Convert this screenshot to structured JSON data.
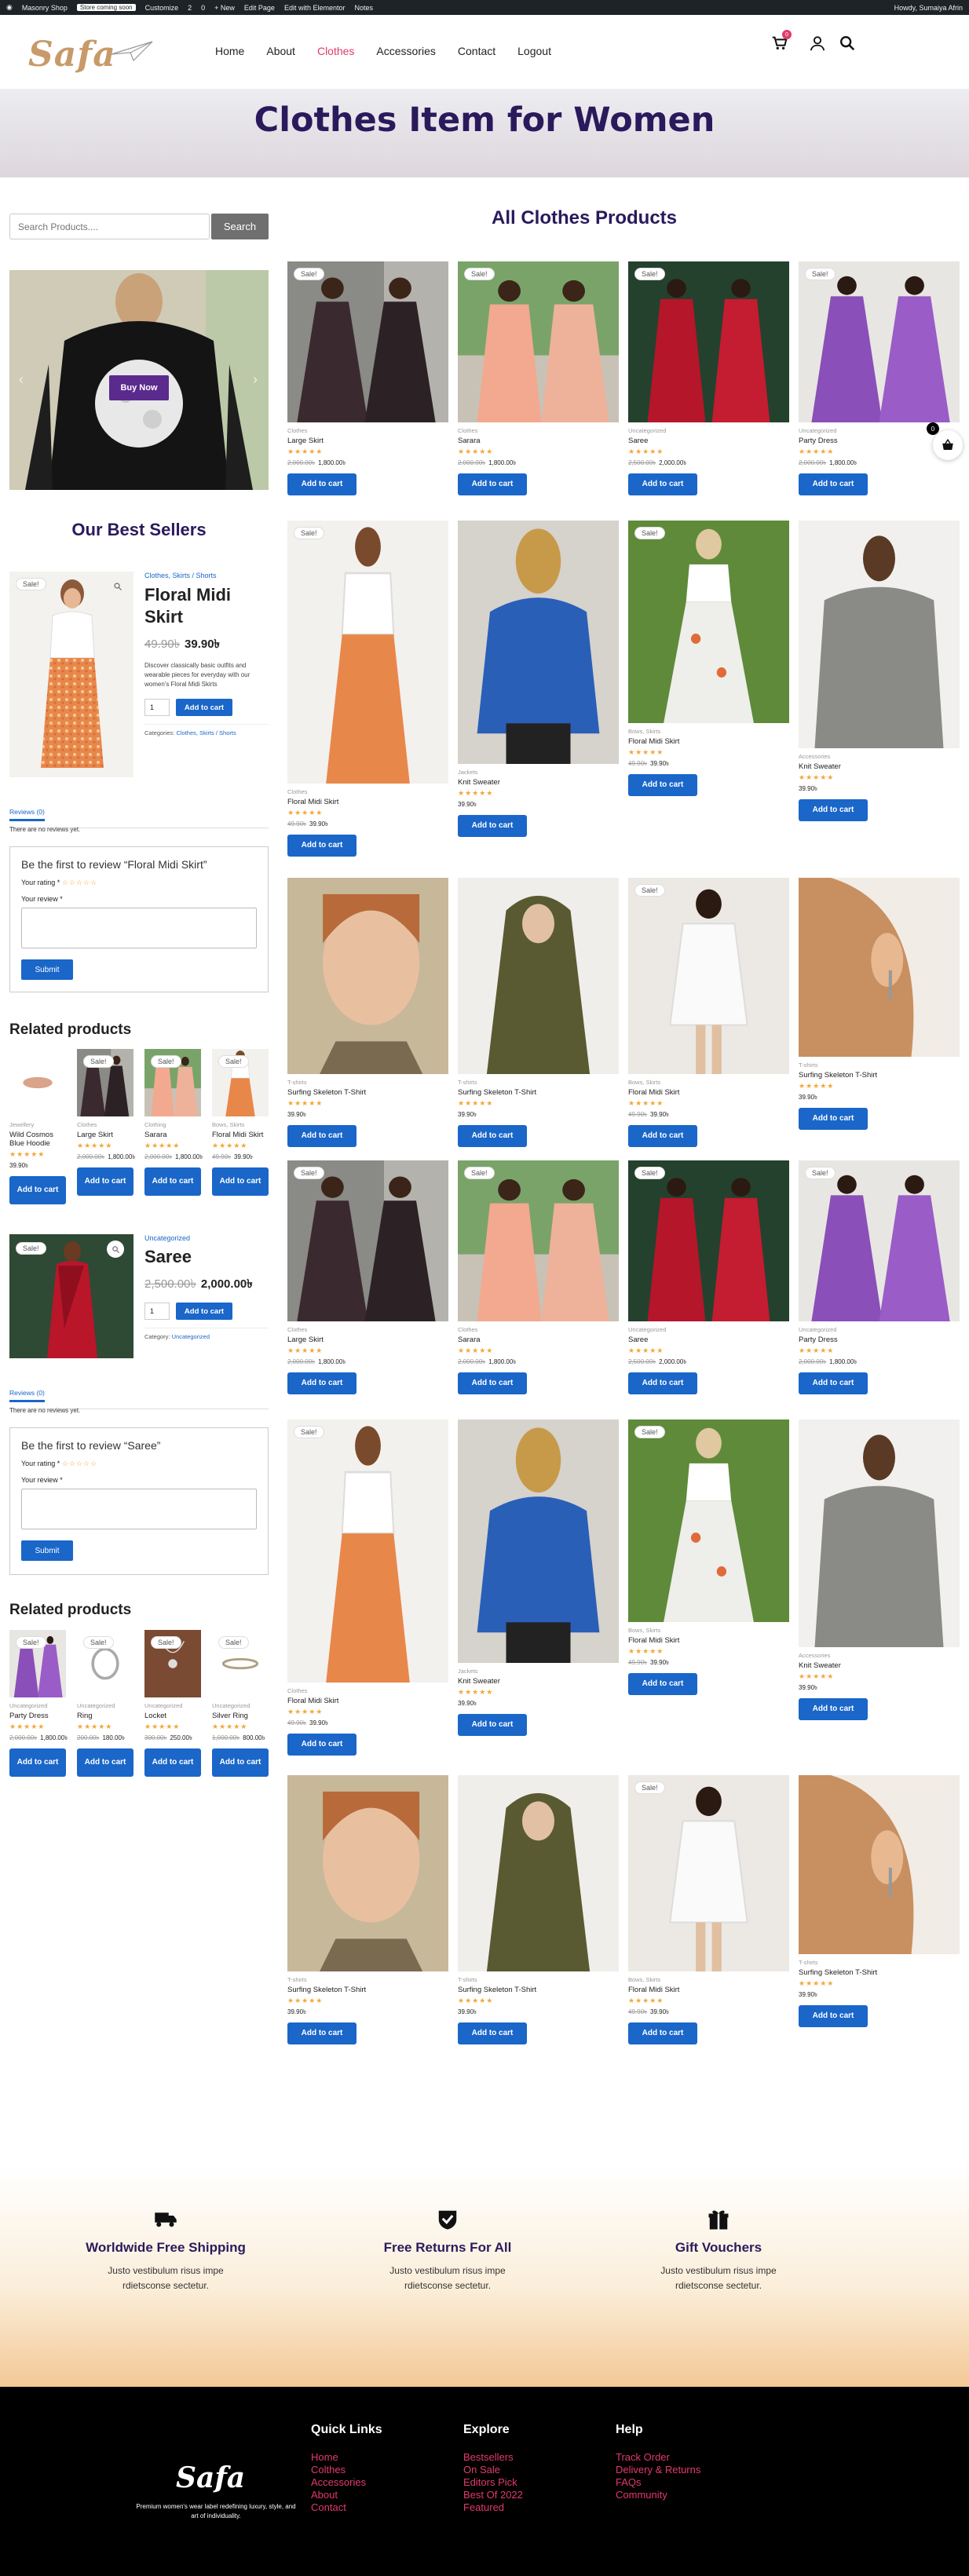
{
  "admin_bar": {
    "items": [
      "Masonry Shop",
      "Customize",
      "2",
      "0",
      "+ New",
      "Edit Page",
      "Edit with Elementor",
      "Notes"
    ],
    "pill": "Store coming soon",
    "greeting": "Howdy, Sumaiya Afrin"
  },
  "header": {
    "logo": "Safa",
    "nav": [
      "Home",
      "About",
      "Clothes",
      "Accessories",
      "Contact",
      "Logout"
    ],
    "active_nav": "Clothes",
    "cart_count": "0"
  },
  "hero": {
    "title": "Clothes Item for Women"
  },
  "sidebar": {
    "search": {
      "placeholder": "Search Products....",
      "button": "Search"
    },
    "banner_button": "Buy Now",
    "best_sellers_title": "Our Best Sellers",
    "featured1": {
      "breadcrumb": "Clothes, Skirts / Shorts",
      "name": "Floral Midi Skirt",
      "old_price": "49.90৳",
      "price": "39.90৳",
      "desc": "Discover classically basic outfits and wearable pieces for everyday with our women's Floral Midi Skirts",
      "qty": "1",
      "add_btn": "Add to cart",
      "categories_label": "Categories:",
      "categories": "Clothes, Skirts / Shorts",
      "sale": "Sale!"
    },
    "reviews1": {
      "tab": "Reviews (0)",
      "none": "There are no reviews yet.",
      "title": "Be the first to review “Floral Midi Skirt”",
      "rating_label": "Your rating *",
      "review_label": "Your review *",
      "submit": "Submit"
    },
    "related1": {
      "title": "Related products",
      "items": [
        {
          "cat": "Jewellery",
          "name": "Wild Cosmos Blue Hoodie",
          "old": "",
          "price": "39.90৳",
          "btn": "Add to cart",
          "sale": ""
        },
        {
          "cat": "Clothes",
          "name": "Large Skirt",
          "old": "2,000.00৳",
          "price": "1,800.00৳",
          "btn": "Add to cart",
          "sale": "Sale!"
        },
        {
          "cat": "Clothing",
          "name": "Sarara",
          "old": "2,000.00৳",
          "price": "1,800.00৳",
          "btn": "Add to cart",
          "sale": "Sale!"
        },
        {
          "cat": "Bows, Skirts",
          "name": "Floral Midi Skirt",
          "old": "49.90৳",
          "price": "39.90৳",
          "btn": "Add to cart",
          "sale": "Sale!"
        }
      ]
    },
    "featured2": {
      "category": "Uncategorized",
      "name": "Saree",
      "old_price": "2,500.00৳",
      "price": "2,000.00৳",
      "qty": "1",
      "add_btn": "Add to cart",
      "categories_label": "Category:",
      "categories": "Uncategorized",
      "sale": "Sale!"
    },
    "reviews2": {
      "tab": "Reviews (0)",
      "none": "There are no reviews yet.",
      "title": "Be the first to review “Saree”",
      "rating_label": "Your rating *",
      "review_label": "Your review *",
      "submit": "Submit"
    },
    "related2": {
      "title": "Related products",
      "items": [
        {
          "cat": "Uncategorized",
          "name": "Party Dress",
          "old": "2,000.00৳",
          "price": "1,800.00৳",
          "btn": "Add to cart",
          "sale": "Sale!"
        },
        {
          "cat": "Uncategorized",
          "name": "Ring",
          "old": "200.00৳",
          "price": "180.00৳",
          "btn": "Add to cart",
          "sale": "Sale!"
        },
        {
          "cat": "Uncategorized",
          "name": "Locket",
          "old": "300.00৳",
          "price": "250.00৳",
          "btn": "Add to cart",
          "sale": "Sale!"
        },
        {
          "cat": "Uncategorized",
          "name": "Silver Ring",
          "old": "1,000.00৳",
          "price": "800.00৳",
          "btn": "Add to cart",
          "sale": "Sale!"
        }
      ]
    }
  },
  "main": {
    "title": "All Clothes Products",
    "products": [
      {
        "cat": "Clothes",
        "name": "Large Skirt",
        "old": "2,000.00৳",
        "price": "1,800.00৳",
        "btn": "Add to cart",
        "sale": "Sale!"
      },
      {
        "cat": "Clothes",
        "name": "Sarara",
        "old": "2,000.00৳",
        "price": "1,800.00৳",
        "btn": "Add to cart",
        "sale": "Sale!"
      },
      {
        "cat": "Uncategorized",
        "name": "Saree",
        "old": "2,500.00৳",
        "price": "2,000.00৳",
        "btn": "Add to cart",
        "sale": "Sale!"
      },
      {
        "cat": "Uncategorized",
        "name": "Party Dress",
        "old": "2,000.00৳",
        "price": "1,800.00৳",
        "btn": "Add to cart",
        "sale": "Sale!"
      },
      {
        "cat": "Clothes",
        "name": "Floral Midi Skirt",
        "old": "49.90৳",
        "price": "39.90৳",
        "btn": "Add to cart",
        "sale": "Sale!"
      },
      {
        "cat": "Jackets",
        "name": "Knit Sweater",
        "old": "",
        "price": "39.90৳",
        "btn": "Add to cart",
        "sale": ""
      },
      {
        "cat": "Bows, Skirts",
        "name": "Floral Midi Skirt",
        "old": "49.90৳",
        "price": "39.90৳",
        "btn": "Add to cart",
        "sale": "Sale!"
      },
      {
        "cat": "Accessories",
        "name": "Knit Sweater",
        "old": "",
        "price": "39.90৳",
        "btn": "Add to cart",
        "sale": ""
      },
      {
        "cat": "T-shirts",
        "name": "Surfing Skeleton T-Shirt",
        "old": "",
        "price": "39.90৳",
        "btn": "Add to cart",
        "sale": ""
      },
      {
        "cat": "T-shirts",
        "name": "Surfing Skeleton T-Shirt",
        "old": "",
        "price": "39.90৳",
        "btn": "Add to cart",
        "sale": ""
      },
      {
        "cat": "Bows, Skirts",
        "name": "Floral Midi Skirt",
        "old": "49.90৳",
        "price": "39.90৳",
        "btn": "Add to cart",
        "sale": "Sale!"
      },
      {
        "cat": "T-shirts",
        "name": "Surfing Skeleton T-Shirt",
        "old": "",
        "price": "39.90৳",
        "btn": "Add to cart",
        "sale": ""
      },
      {
        "cat": "Clothes",
        "name": "Large Skirt",
        "old": "2,000.00৳",
        "price": "1,800.00৳",
        "btn": "Add to cart",
        "sale": "Sale!"
      },
      {
        "cat": "Clothes",
        "name": "Sarara",
        "old": "2,000.00৳",
        "price": "1,800.00৳",
        "btn": "Add to cart",
        "sale": "Sale!"
      },
      {
        "cat": "Uncategorized",
        "name": "Saree",
        "old": "2,500.00৳",
        "price": "2,000.00৳",
        "btn": "Add to cart",
        "sale": "Sale!"
      },
      {
        "cat": "Uncategorized",
        "name": "Party Dress",
        "old": "2,000.00৳",
        "price": "1,800.00৳",
        "btn": "Add to cart",
        "sale": "Sale!"
      },
      {
        "cat": "Clothes",
        "name": "Floral Midi Skirt",
        "old": "49.90৳",
        "price": "39.90৳",
        "btn": "Add to cart",
        "sale": "Sale!"
      },
      {
        "cat": "Jackets",
        "name": "Knit Sweater",
        "old": "",
        "price": "39.90৳",
        "btn": "Add to cart",
        "sale": ""
      },
      {
        "cat": "Bows, Skirts",
        "name": "Floral Midi Skirt",
        "old": "49.90৳",
        "price": "39.90৳",
        "btn": "Add to cart",
        "sale": "Sale!"
      },
      {
        "cat": "Accessories",
        "name": "Knit Sweater",
        "old": "",
        "price": "39.90৳",
        "btn": "Add to cart",
        "sale": ""
      },
      {
        "cat": "T-shirts",
        "name": "Surfing Skeleton T-Shirt",
        "old": "",
        "price": "39.90৳",
        "btn": "Add to cart",
        "sale": ""
      },
      {
        "cat": "T-shirts",
        "name": "Surfing Skeleton T-Shirt",
        "old": "",
        "price": "39.90৳",
        "btn": "Add to cart",
        "sale": ""
      },
      {
        "cat": "Bows, Skirts",
        "name": "Floral Midi Skirt",
        "old": "49.90৳",
        "price": "39.90৳",
        "btn": "Add to cart",
        "sale": "Sale!"
      },
      {
        "cat": "T-shirts",
        "name": "Surfing Skeleton T-Shirt",
        "old": "",
        "price": "39.90৳",
        "btn": "Add to cart",
        "sale": ""
      }
    ]
  },
  "features": [
    {
      "icon": "truck-icon",
      "title": "Worldwide Free Shipping",
      "desc": "Justo vestibulum risus impe rdietsconse sectetur."
    },
    {
      "icon": "shield-check-icon",
      "title": "Free Returns For All",
      "desc": "Justo vestibulum risus impe rdietsconse sectetur."
    },
    {
      "icon": "gift-icon",
      "title": "Gift Vouchers",
      "desc": "Justo vestibulum risus impe rdietsconse sectetur."
    }
  ],
  "footer": {
    "logo": "Safa",
    "tagline": "Premium women's wear label redefining luxury, style, and art of individuality.",
    "columns": [
      {
        "title": "Quick Links",
        "links": [
          "Home",
          "Colthes",
          "Accessories",
          "About",
          "Contact"
        ]
      },
      {
        "title": "Explore",
        "links": [
          "Bestsellers",
          "On Sale",
          "Editors Pick",
          "Best Of 2022",
          "Featured"
        ]
      },
      {
        "title": "Help",
        "links": [
          "Track Order",
          "Delivery & Returns",
          "FAQs",
          "Community"
        ]
      }
    ]
  },
  "floating_cart": {
    "count": "0"
  },
  "colors": {
    "brand_purple": "#2a1a5c",
    "accent_pink": "#e13a6b",
    "button_blue": "#1a66c9",
    "star": "#f4a63a"
  }
}
